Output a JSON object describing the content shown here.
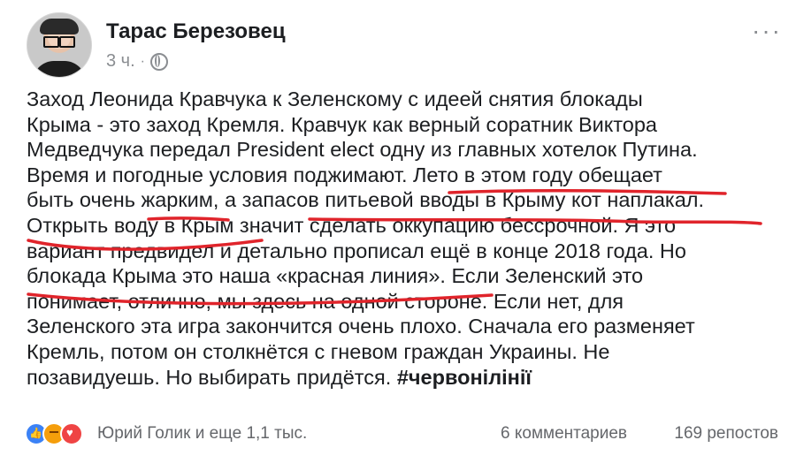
{
  "post": {
    "author": "Тарас Березовец",
    "time": "3 ч.",
    "separator": "·",
    "privacy_icon": "globe-icon",
    "more_icon": "more-horizontal-icon",
    "lines": [
      "Заход Леонида Кравчука к Зеленскому с идеей снятия блокады",
      "Крыма - это заход Кремля. Кравчук как верный соратник Виктора",
      "Медведчука передал President elect одну из главных хотелок Путина.",
      "Время и погодные условия поджимают. Лето в этом году обещает",
      "быть очень жарким, а запасов питьевой вводы в Крыму кот наплакал.",
      "Открыть воду в Крым значит сделать оккупацию бессрочной. Я это",
      "вариант предвидел и детально прописал ещё в конце 2018 года. Но",
      "блокада Крыма это наша «красная линия». Если Зеленский это",
      "понимает, отлично, мы здесь на одной стороне. Если нет, для",
      "Зеленского эта игра закончится очень плохо. Сначала его разменяет",
      "Кремль, потом он столкнётся с гневом граждан Украины. Не"
    ],
    "last_line": "позавидуешь. Но выбирать придётся.",
    "hashtag": "#червонілінії",
    "underline_color": "#e0242b"
  },
  "footer": {
    "reaction_icons": [
      "like-icon",
      "angry-icon",
      "love-icon"
    ],
    "reactors": "Юрий Голик и еще 1,1 тыс.",
    "comments": "6 комментариев",
    "shares": "169 репостов"
  }
}
